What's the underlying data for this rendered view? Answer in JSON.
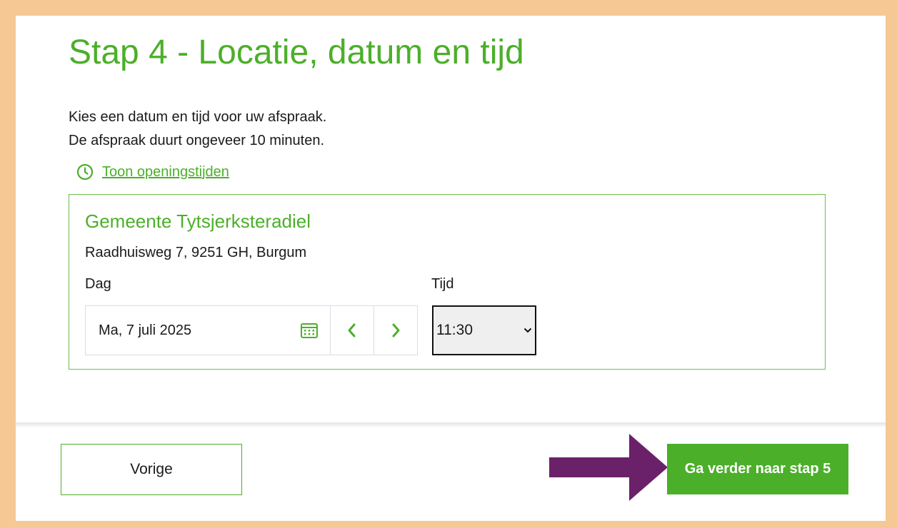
{
  "page": {
    "title": "Stap 4 - Locatie, datum en tijd",
    "intro_line1": "Kies een datum en tijd voor uw afspraak.",
    "intro_line2": "De afspraak duurt ongeveer 10 minuten."
  },
  "hours_link": {
    "label": "Toon openingstijden",
    "icon": "clock-icon"
  },
  "location": {
    "name": "Gemeente Tytsjerksteradiel",
    "address": "Raadhuisweg 7, 9251 GH, Burgum",
    "day_label": "Dag",
    "time_label": "Tijd",
    "date_value": "Ma, 7 juli 2025",
    "time_value": "11:30"
  },
  "footer": {
    "prev_label": "Vorige",
    "next_label": "Ga verder naar stap 5"
  },
  "colors": {
    "frame": "#f5c894",
    "brand_green": "#4caf2a",
    "arrow_purple": "#6b2169"
  }
}
